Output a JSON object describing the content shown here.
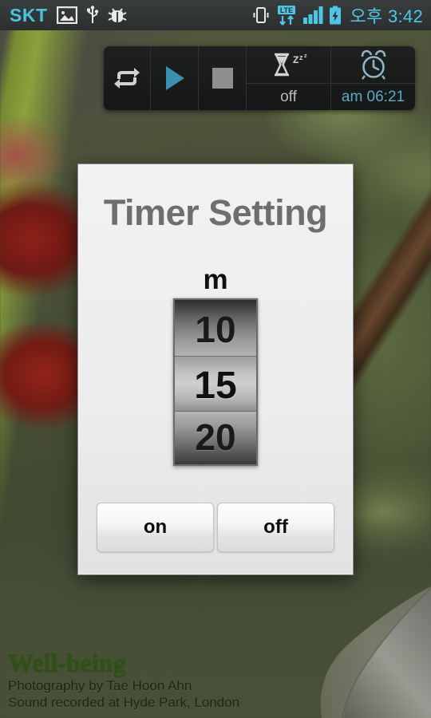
{
  "statusbar": {
    "carrier": "SKT",
    "clock": "오후 3:42",
    "icons": [
      {
        "name": "screenshot-icon"
      },
      {
        "name": "usb-icon"
      },
      {
        "name": "bug-icon"
      },
      {
        "name": "vibrate-icon"
      },
      {
        "name": "lte-data-icon",
        "label": "LTE"
      },
      {
        "name": "signal-bars-icon"
      },
      {
        "name": "battery-charging-icon"
      }
    ]
  },
  "widget": {
    "repeat_icon": "repeat-icon",
    "play_icon": "play-icon",
    "stop_icon": "stop-icon",
    "sleep_icon": "hourglass-sleep-icon",
    "sleep_state": "off",
    "alarm_icon": "alarm-clock-icon",
    "alarm_time": "am 06:21"
  },
  "dialog": {
    "title": "Timer Setting",
    "unit_label": "m",
    "spinner": {
      "previous": "10",
      "selected": "15",
      "next": "20"
    },
    "buttons": {
      "on": "on",
      "off": "off"
    }
  },
  "credits": {
    "title": "Well-being",
    "line1": "Photography by Tae Hoon Ahn",
    "line2": "Sound recorded at Hyde Park, London"
  },
  "colors": {
    "carrier_cyan": "#49c3e0",
    "clock_cyan": "#4fc7e4",
    "play_blue": "#3d8fb0",
    "alarm_blue": "#5ba8c4",
    "title_gray": "#6e6e6e",
    "credit_green": "#2f5212"
  }
}
